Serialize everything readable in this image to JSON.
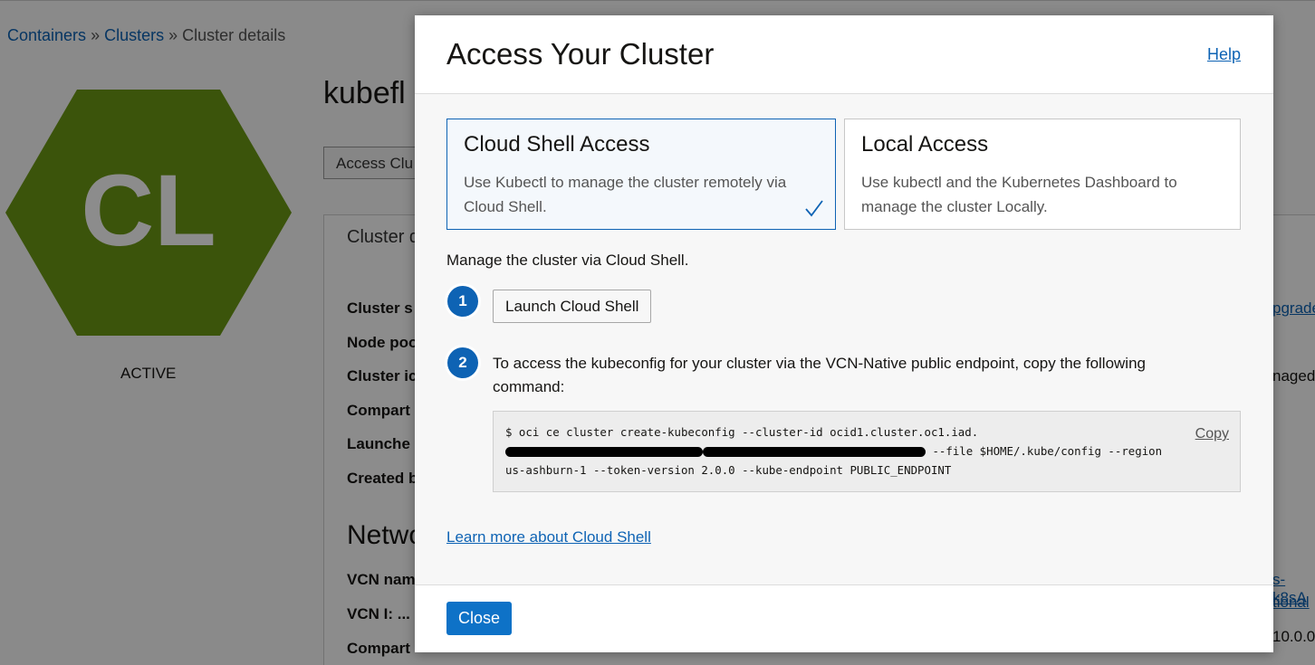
{
  "breadcrumb": {
    "containers": "Containers",
    "sep1": "»",
    "clusters": "Clusters",
    "sep2": "»",
    "current": "Cluster details"
  },
  "cluster": {
    "initials": "CL",
    "status": "ACTIVE",
    "name_fragment": "kubefl",
    "access_button_fragment": "Access Clu",
    "colors": {
      "hex": "#5f8a11"
    }
  },
  "details_panel": {
    "title_fragment": "Cluster d",
    "rows": [
      "Cluster s",
      "Node poo",
      "Cluster ic",
      "Compart",
      "Launche",
      "Created b"
    ],
    "network_title_fragment": "Netwo",
    "network_rows": [
      "VCN nam",
      "VCN I: ...",
      "Compart"
    ]
  },
  "right_fragments": {
    "upgrade": "pgrade",
    "managed": "naged",
    "k8s": "s-k8sA",
    "optional": "tional",
    "ip": "10.0.0."
  },
  "modal": {
    "title": "Access Your Cluster",
    "help": "Help",
    "options": [
      {
        "title": "Cloud Shell Access",
        "description": "Use Kubectl to manage the cluster remotely via Cloud Shell.",
        "selected": true
      },
      {
        "title": "Local Access",
        "description": "Use kubectl and the Kubernetes Dashboard to manage the cluster Locally.",
        "selected": false
      }
    ],
    "manage_text": "Manage the cluster via Cloud Shell.",
    "step1": {
      "number": "1",
      "button": "Launch Cloud Shell"
    },
    "step2": {
      "number": "2",
      "text": "To access the kubeconfig for your cluster via the VCN-Native public endpoint, copy the following command:"
    },
    "command": {
      "part1": "$ oci ce cluster create-kubeconfig --cluster-id ocid1.cluster.oc1.iad.",
      "part2": " --file $HOME/.kube/config --region us-ashburn-1 --token-version 2.0.0  --kube-endpoint PUBLIC_ENDPOINT",
      "copy": "Copy"
    },
    "learn_more": "Learn more about Cloud Shell",
    "close": "Close",
    "colors": {
      "accent": "#0e63b4",
      "primary_button": "#0e72c7"
    }
  }
}
